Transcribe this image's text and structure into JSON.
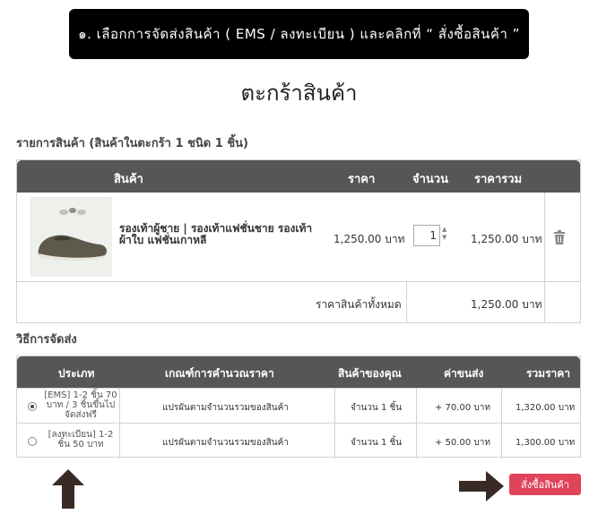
{
  "banner": {
    "text": "๑. เลือกการจัดส่งสินค้า ( EMS / ลงทะเบียน ) และคลิกที่ “ สั่งซื้อสินค้า ”"
  },
  "page_title": "ตะกร้าสินค้า",
  "cart": {
    "heading": "รายการสินค้า (สินค้าในตะกร้า 1 ชนิด 1 ชิ้น)",
    "columns": {
      "product": "สินค้า",
      "price": "ราคา",
      "qty": "จำนวน",
      "total": "ราคารวม"
    },
    "items": [
      {
        "name": "รองเท้าผู้ชาย | รองเท้าแฟชั่นชาย รองเท้าผ้าใบ แฟชั่นเกาหลี",
        "price": "1,250.00 บาท",
        "qty": "1",
        "total": "1,250.00 บาท"
      }
    ],
    "grand_total_label": "ราคาสินค้าทั้งหมด",
    "grand_total_value": "1,250.00 บาท"
  },
  "shipping": {
    "heading": "วิธีการจัดส่ง",
    "columns": {
      "type": "ประเภท",
      "criteria": "เกณฑ์การคำนวณราคา",
      "your_items": "สินค้าของคุณ",
      "fee": "ค่าขนส่ง",
      "total": "รวมราคา"
    },
    "options": [
      {
        "type": "[EMS] 1-2 ชิ้น 70 บาท / 3 ชิ้นขึ้นไป จัดส่งฟรี",
        "criteria": "แปรผันตามจำนวนรวมของสินค้า",
        "your_items": "จำนวน 1 ชิ้น",
        "fee": "+ 70.00 บาท",
        "total": "1,320.00 บาท",
        "selected": true
      },
      {
        "type": "[ลงทะเบียน] 1-2 ชิ้น 50 บาท",
        "criteria": "แปรผันตามจำนวนรวมของสินค้า",
        "your_items": "จำนวน 1 ชิ้น",
        "fee": "+ 50.00 บาท",
        "total": "1,300.00 บาท",
        "selected": false
      }
    ]
  },
  "order_button": "สั่งซื้อสินค้า",
  "colors": {
    "header_bg": "#565656",
    "banner_bg": "#000000",
    "order_button": "#e0445a",
    "arrow": "#3a2a26"
  }
}
